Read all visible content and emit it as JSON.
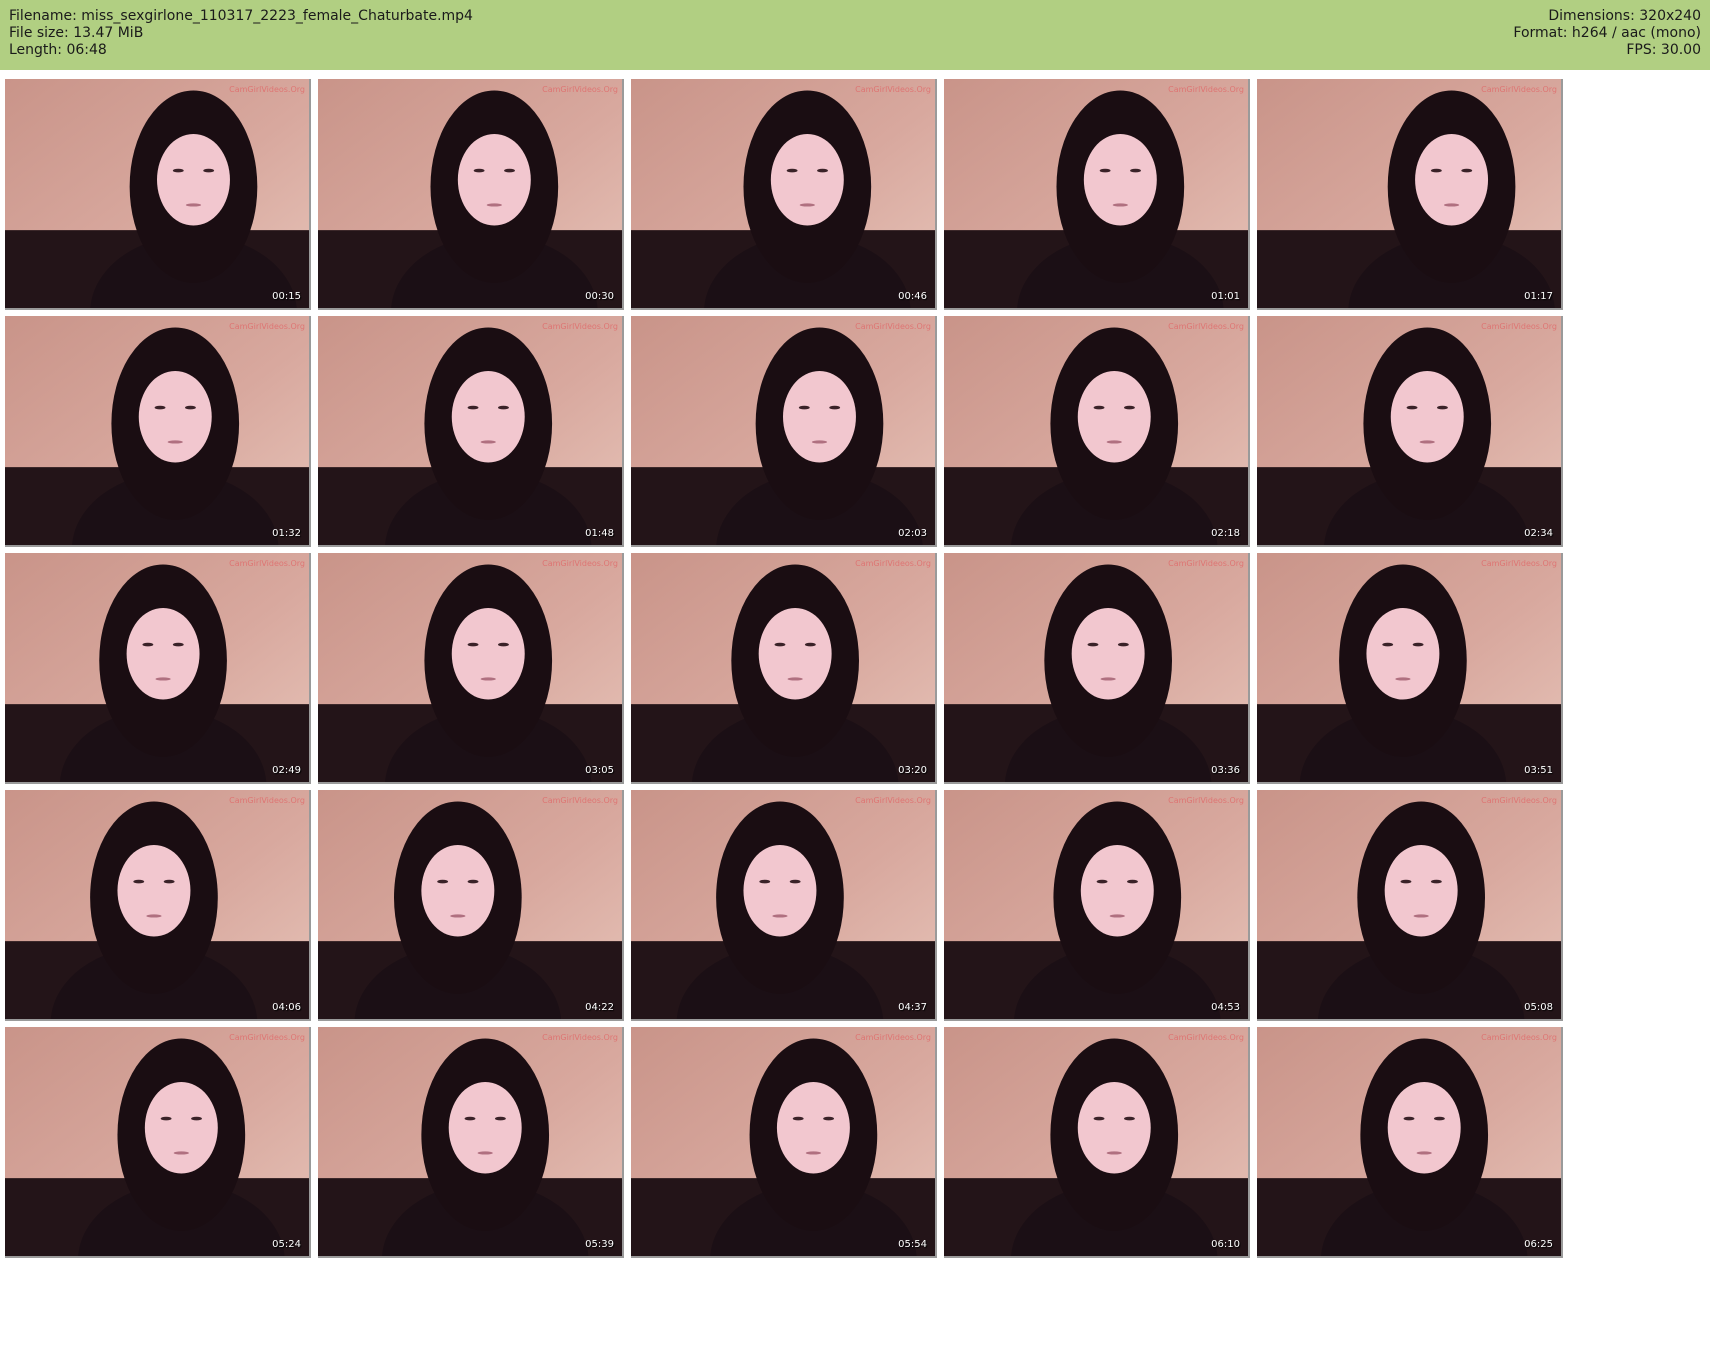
{
  "header": {
    "background": "#b1cf82",
    "left": {
      "filename": "Filename: miss_sexgirlone_110317_2223_female_Chaturbate.mp4",
      "filesize": "File size: 13.47 MiB",
      "length": "Length: 06:48"
    },
    "right": {
      "dimensions": "Dimensions: 320x240",
      "format": "Format: h264 / aac (mono)",
      "fps": "FPS: 30.00"
    }
  },
  "thumbnails": [
    {
      "time": "00:15"
    },
    {
      "time": "00:30"
    },
    {
      "time": "00:46"
    },
    {
      "time": "01:01"
    },
    {
      "time": "01:17"
    },
    {
      "time": "01:32"
    },
    {
      "time": "01:48"
    },
    {
      "time": "02:03"
    },
    {
      "time": "02:18"
    },
    {
      "time": "02:34"
    },
    {
      "time": "02:49"
    },
    {
      "time": "03:05"
    },
    {
      "time": "03:20"
    },
    {
      "time": "03:36"
    },
    {
      "time": "03:51"
    },
    {
      "time": "04:06"
    },
    {
      "time": "04:22"
    },
    {
      "time": "04:37"
    },
    {
      "time": "04:53"
    },
    {
      "time": "05:08"
    },
    {
      "time": "05:24"
    },
    {
      "time": "05:39"
    },
    {
      "time": "05:54"
    },
    {
      "time": "06:10"
    },
    {
      "time": "06:25"
    }
  ],
  "watermark": "CamGirlVideos.Org",
  "colors": {
    "wall": "#d8a89e",
    "hair": "#1a0d12",
    "skin": "#f2c7cf",
    "clothing": "#1b0f15",
    "watermark": "#e06a6a"
  }
}
